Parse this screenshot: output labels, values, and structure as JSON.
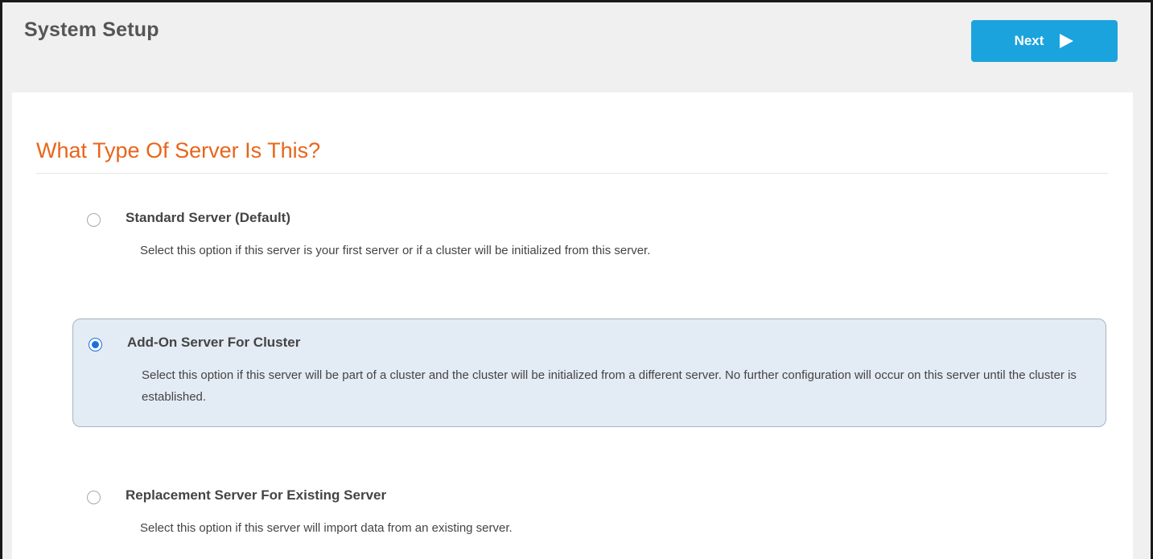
{
  "header": {
    "title": "System Setup",
    "next_label": "Next",
    "next_icon": "play-arrow-icon"
  },
  "main": {
    "heading": "What Type Of Server Is This?",
    "options": [
      {
        "label": "Standard Server (Default)",
        "description": "Select this option if this server is your first server or if a cluster will be initialized from this server.",
        "selected": false
      },
      {
        "label": "Add-On Server For Cluster",
        "description": "Select this option if this server will be part of a cluster and the cluster will be initialized from a different server. No further configuration will occur on this server until the cluster is established.",
        "selected": true
      },
      {
        "label": "Replacement Server For Existing Server",
        "description": "Select this option if this server will import data from an existing server.",
        "selected": false
      }
    ]
  },
  "colors": {
    "accent": "#1ba3dd",
    "heading": "#e8651a",
    "selected_bg": "#e3ebf4",
    "radio_checked": "#1a6fe0"
  }
}
